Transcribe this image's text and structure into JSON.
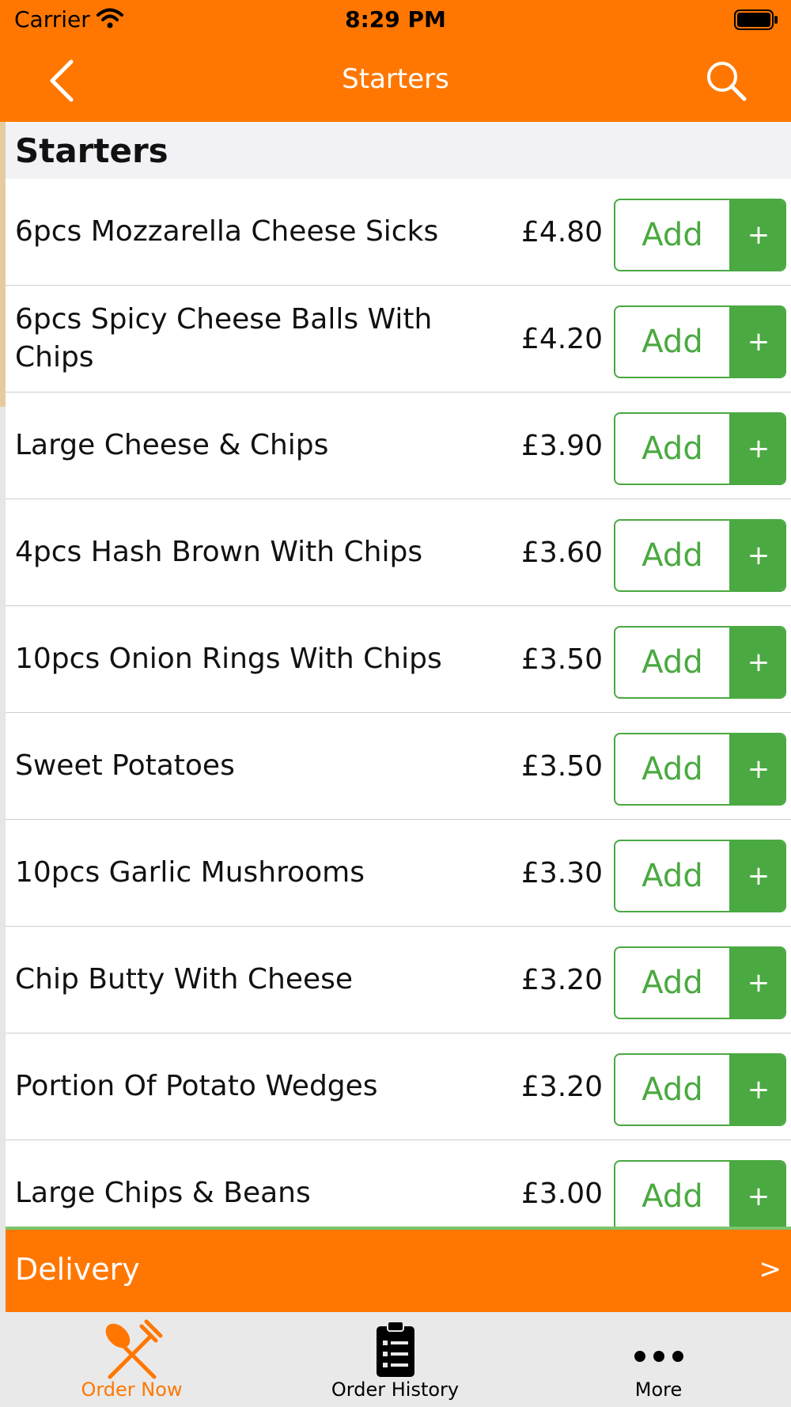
{
  "status_bar": {
    "carrier": "Carrier",
    "time": "8:29 PM"
  },
  "nav": {
    "title": "Starters",
    "back_icon": "chevron-left-icon",
    "search_icon": "search-icon"
  },
  "section": {
    "title": "Starters"
  },
  "add_label": "Add",
  "plus_label": "+",
  "items": [
    {
      "name": "6pcs Mozzarella Cheese Sicks",
      "price": "£4.80"
    },
    {
      "name": "6pcs Spicy Cheese Balls With Chips",
      "price": "£4.20"
    },
    {
      "name": "Large Cheese & Chips",
      "price": "£3.90"
    },
    {
      "name": "4pcs Hash Brown With Chips",
      "price": "£3.60"
    },
    {
      "name": "10pcs Onion Rings With Chips",
      "price": "£3.50"
    },
    {
      "name": "Sweet Potatoes",
      "price": "£3.50"
    },
    {
      "name": "10pcs Garlic Mushrooms",
      "price": "£3.30"
    },
    {
      "name": "Chip Butty With Cheese",
      "price": "£3.20"
    },
    {
      "name": "Portion Of Potato Wedges",
      "price": "£3.20"
    },
    {
      "name": "Large Chips & Beans",
      "price": "£3.00"
    }
  ],
  "delivery": {
    "label": "Delivery",
    "arrow": ">"
  },
  "tabs": [
    {
      "label": "Order Now",
      "icon": "fork-knife-icon",
      "active": true
    },
    {
      "label": "Order History",
      "icon": "clipboard-list-icon",
      "active": false
    },
    {
      "label": "More",
      "icon": "more-dots-icon",
      "active": false
    }
  ],
  "colors": {
    "brand_orange": "#ff7700",
    "add_green": "#4aa941",
    "tab_active": "#ff7700",
    "tab_inactive": "#000000"
  }
}
